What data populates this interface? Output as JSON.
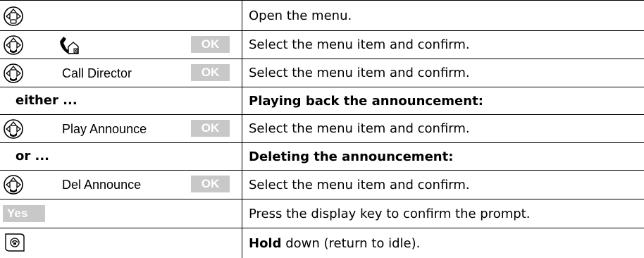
{
  "rows": [
    {
      "description": "Open the menu."
    },
    {
      "ok_label": "OK",
      "description": "Select the menu item and confirm."
    },
    {
      "item_label": "Call Director",
      "ok_label": "OK",
      "description": "Select the menu item and confirm."
    },
    {
      "section_label": "either ...",
      "description": "Playing back the announcement:"
    },
    {
      "item_label": "Play Announce",
      "ok_label": "OK",
      "description": "Select the menu item and confirm."
    },
    {
      "section_label": "or ...",
      "description": "Deleting the announcement:"
    },
    {
      "item_label": "Del Announce",
      "ok_label": "OK",
      "description": "Select the menu item and confirm."
    },
    {
      "key_label": "Yes",
      "description": "Press the display key to confirm the prompt."
    },
    {
      "description_bold": "Hold",
      "description_rest": " down (return to idle)."
    }
  ],
  "icons": {
    "navigation_key": "nav-key-icon",
    "answer_machine": "answer-machine-icon",
    "end_call_key": "end-call-key-icon"
  }
}
